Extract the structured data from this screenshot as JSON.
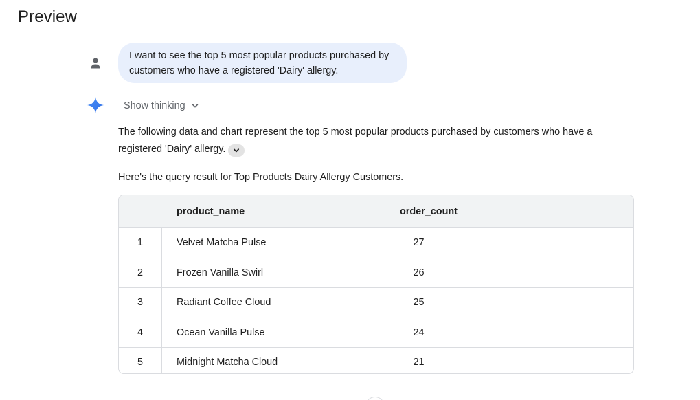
{
  "page": {
    "title": "Preview"
  },
  "user_message": {
    "text": "I want to see the top 5 most popular products purchased by customers who have a registered 'Dairy' allergy."
  },
  "assistant": {
    "show_thinking_label": "Show thinking",
    "response_text": "The following data and chart represent the top 5 most popular products purchased by customers who have a registered 'Dairy' allergy.",
    "query_label": "Here's the query result for Top Products Dairy Allergy Customers."
  },
  "table": {
    "columns": [
      "product_name",
      "order_count"
    ],
    "rows": [
      {
        "index": "1",
        "product_name": "Velvet Matcha Pulse",
        "order_count": "27"
      },
      {
        "index": "2",
        "product_name": "Frozen Vanilla Swirl",
        "order_count": "26"
      },
      {
        "index": "3",
        "product_name": "Radiant Coffee Cloud",
        "order_count": "25"
      },
      {
        "index": "4",
        "product_name": "Ocean Vanilla Pulse",
        "order_count": "24"
      },
      {
        "index": "5",
        "product_name": "Midnight Matcha Cloud",
        "order_count": "21"
      }
    ]
  },
  "icons": {
    "user": "person-icon",
    "assistant": "sparkle-icon",
    "thinking_toggle": "chevron-down-icon",
    "expand": "chevron-down-icon"
  },
  "colors": {
    "user_bubble": "#e8effc",
    "table_header": "#f1f3f4",
    "border": "#dadce0",
    "sparkle_blue": "#3c7ff4"
  }
}
